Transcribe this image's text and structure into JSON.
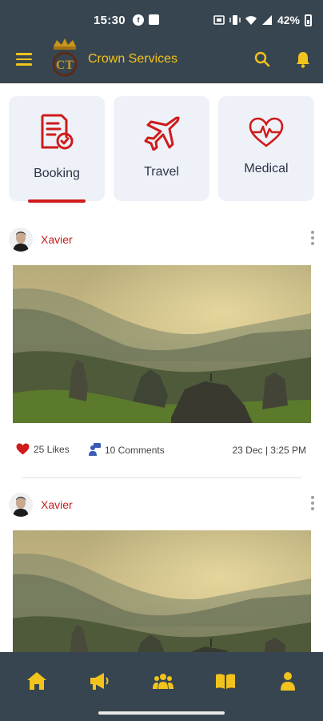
{
  "status_bar": {
    "time": "15:30",
    "battery": "42%"
  },
  "app_bar": {
    "brand_name": "Crown Services",
    "logo_text": "CT"
  },
  "categories": [
    {
      "label": "Booking",
      "icon": "booking-icon",
      "selected": true
    },
    {
      "label": "Travel",
      "icon": "airplane-icon",
      "selected": false
    },
    {
      "label": "Medical",
      "icon": "heartbeat-icon",
      "selected": false
    }
  ],
  "posts": [
    {
      "author": "Xavier",
      "likes": "25 Likes",
      "comments": "10 Comments",
      "date": "23 Dec | 3:25 PM"
    },
    {
      "author": "Xavier"
    }
  ],
  "bottom_nav": [
    "home-icon",
    "megaphone-icon",
    "group-icon",
    "book-icon",
    "profile-icon"
  ],
  "colors": {
    "bar": "#374550",
    "accent_yellow": "#f2c31c",
    "accent_red": "#cf1b1b",
    "card_bg": "#eef1f8"
  }
}
